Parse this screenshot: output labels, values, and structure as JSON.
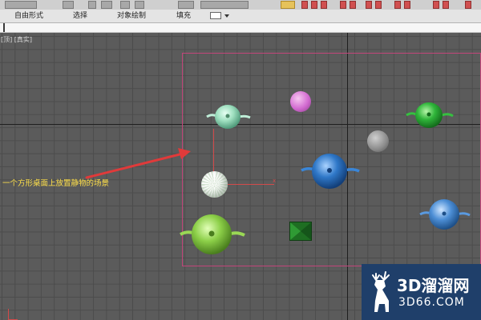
{
  "ribbon": {
    "tabs": [
      {
        "label": "自由形式"
      },
      {
        "label": "选择"
      },
      {
        "label": "对象绘制"
      },
      {
        "label": "填充"
      }
    ]
  },
  "viewport": {
    "label": "[顶] [真实]",
    "axis_marker": "x",
    "annotation": "一个方形桌面上放置静物的场景"
  },
  "scene": {
    "objects": [
      {
        "name": "teapot-mint",
        "color": "#9fe0c0"
      },
      {
        "name": "sphere-pink",
        "color": "#e08ad8"
      },
      {
        "name": "teapot-green-small",
        "color": "#2fb53a"
      },
      {
        "name": "sphere-gray",
        "color": "#9a9a9a"
      },
      {
        "name": "teapot-blue",
        "color": "#2f78c8"
      },
      {
        "name": "geosphere-white",
        "color": "#f2f2f2"
      },
      {
        "name": "teapot-blue-light",
        "color": "#4d8fd6"
      },
      {
        "name": "teapot-lime",
        "color": "#8ccf48"
      },
      {
        "name": "pyramid-green",
        "color": "#1f8a2a"
      }
    ]
  },
  "watermark": {
    "brand": "3D溜溜网",
    "domain": "3D66.COM",
    "logo_icon": "deer-icon"
  },
  "colors": {
    "frame": "#c2457a",
    "annotation_text": "#ffe04a",
    "arrow": "#e03a3a",
    "watermark_bg": "#1f3f6a"
  }
}
